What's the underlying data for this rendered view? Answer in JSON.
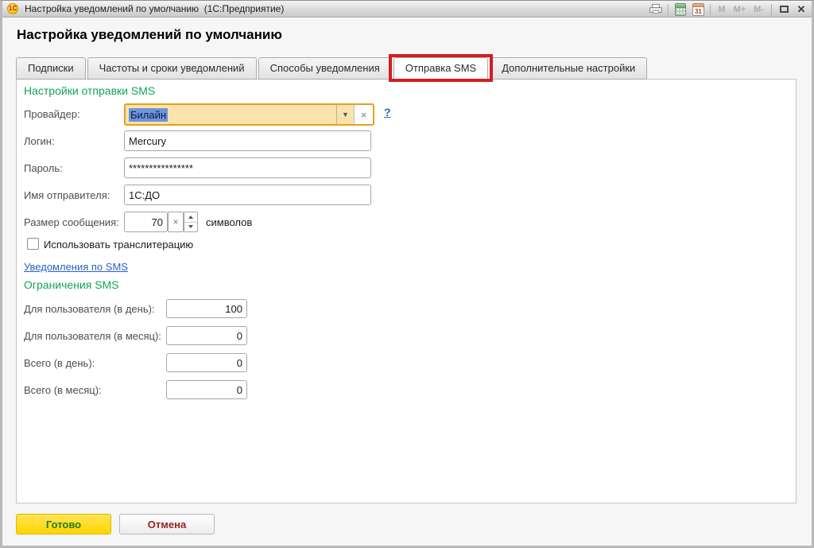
{
  "titlebar": {
    "title": "Настройка уведомлений по умолчанию  (1С:Предприятие)",
    "app_logo": "1С",
    "calendar_day": "31",
    "memory": {
      "m": "M",
      "m_plus": "M+",
      "m_minus": "M-"
    },
    "close_glyph": "✕"
  },
  "page": {
    "title": "Настройка уведомлений по умолчанию"
  },
  "tabs": [
    {
      "label": "Подписки",
      "active": false
    },
    {
      "label": "Частоты и сроки уведомлений",
      "active": false
    },
    {
      "label": "Способы уведомления",
      "active": false
    },
    {
      "label": "Отправка SMS",
      "active": true,
      "annotated": "red-highlight"
    },
    {
      "label": "Дополнительные настройки",
      "active": false
    }
  ],
  "form": {
    "section_sms_title": "Настройки отправки SMS",
    "provider": {
      "label": "Провайдер:",
      "value": "Билайн",
      "dropdown_glyph": "▼",
      "clear_glyph": "×"
    },
    "help_glyph": "?",
    "login": {
      "label": "Логин:",
      "value": "Mercury"
    },
    "password": {
      "label": "Пароль:",
      "value": "****************"
    },
    "sender": {
      "label": "Имя отправителя:",
      "value": "1С:ДО"
    },
    "size": {
      "label": "Размер сообщения:",
      "value": "70",
      "clear_glyph": "×",
      "suffix": "символов"
    },
    "translit": {
      "label": "Использовать транслитерацию",
      "checked": false
    },
    "sms_link": "Уведомления по SMS",
    "section_limits_title": "Ограничения SMS",
    "limits": [
      {
        "label": "Для пользователя (в день):",
        "value": "100"
      },
      {
        "label": "Для пользователя (в месяц):",
        "value": "0"
      },
      {
        "label": "Всего (в день):",
        "value": "0"
      },
      {
        "label": "Всего (в месяц):",
        "value": "0"
      }
    ]
  },
  "footer": {
    "done": "Готово",
    "cancel": "Отмена"
  },
  "colors": {
    "section_green": "#12A456",
    "link_blue": "#2962C4",
    "annotation_red": "#D21D1D",
    "focused_field_bg": "#FBE3AE",
    "focused_field_border": "#E5A11C",
    "selection_bg": "#6E95D6",
    "done_button_bg": "#FFD400",
    "done_button_text": "#1F7D1F",
    "cancel_button_text": "#9B2121"
  }
}
